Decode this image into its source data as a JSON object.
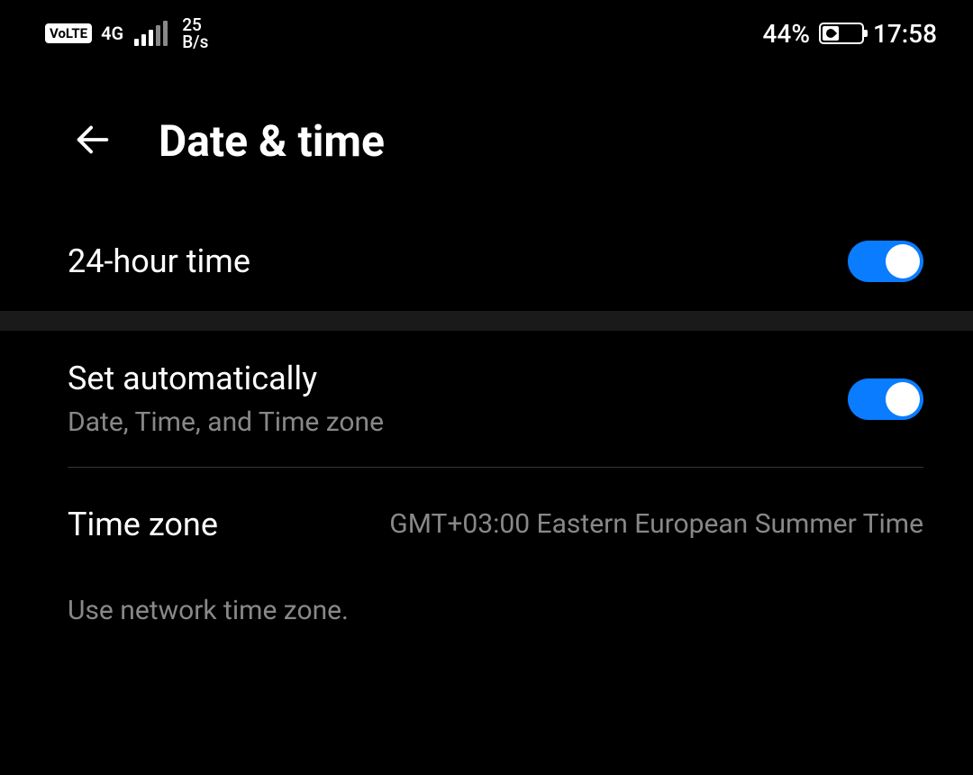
{
  "status": {
    "volte": "VoLTE",
    "network_type": "4G",
    "speed_value": "25",
    "speed_unit": "B/s",
    "battery_percent": "44%",
    "time": "17:58"
  },
  "header": {
    "title": "Date & time"
  },
  "settings": {
    "hour24": {
      "label": "24-hour time",
      "on": true
    },
    "auto": {
      "label": "Set automatically",
      "sub": "Date, Time, and Time zone",
      "on": true
    },
    "timezone": {
      "label": "Time zone",
      "value": "GMT+03:00 Eastern European Summer Time"
    },
    "footer": "Use network time zone."
  }
}
